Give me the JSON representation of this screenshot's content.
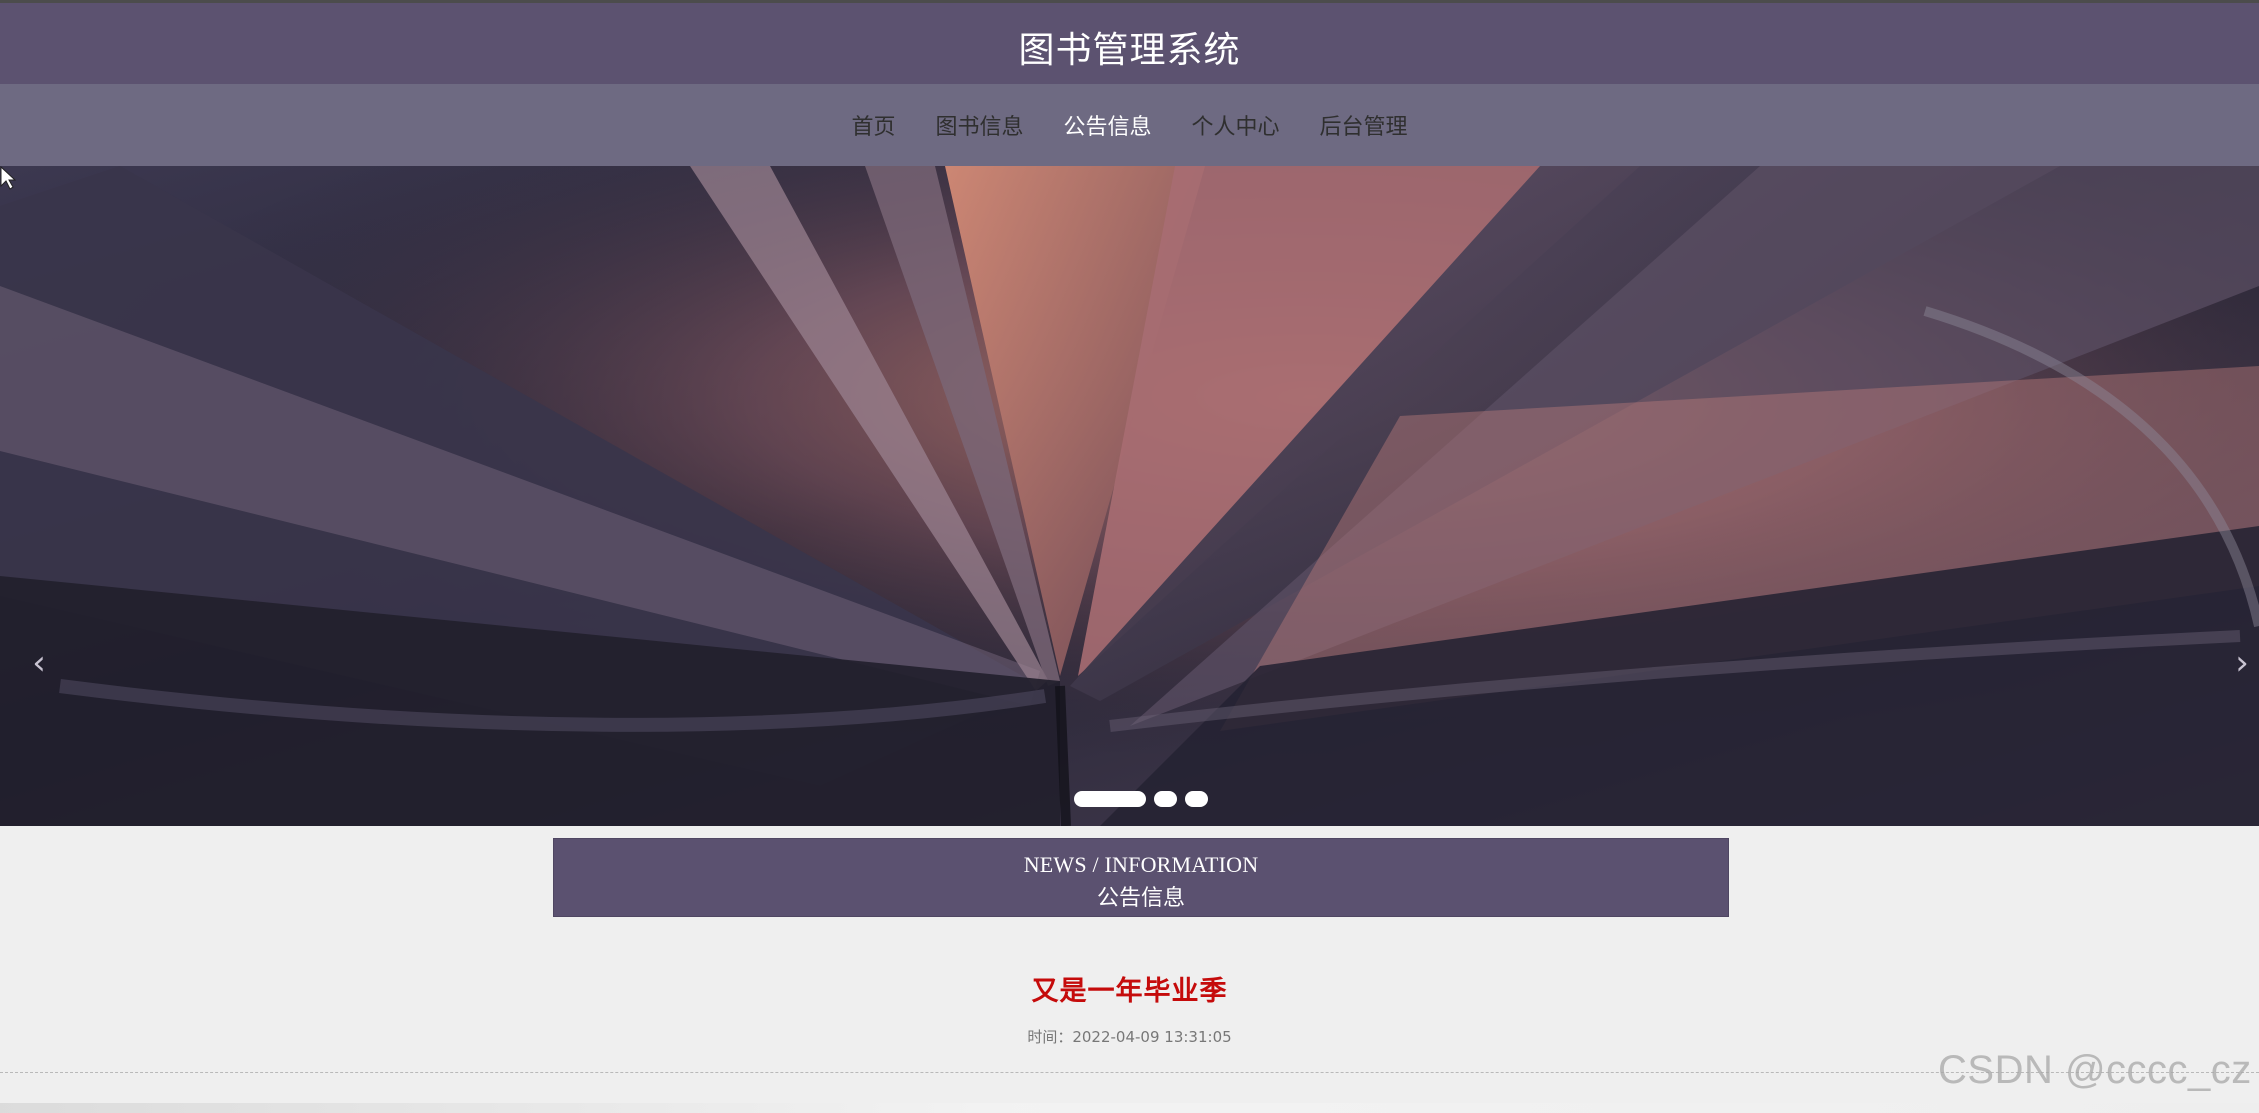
{
  "site": {
    "title": "图书管理系统"
  },
  "nav": {
    "items": [
      {
        "label": "首页"
      },
      {
        "label": "图书信息"
      },
      {
        "label": "公告信息"
      },
      {
        "label": "个人中心"
      },
      {
        "label": "后台管理"
      }
    ],
    "active_label": "公告信息"
  },
  "carousel": {
    "left_arrow": "‹",
    "right_arrow": "›",
    "slide_count": 3,
    "active_slide": 1
  },
  "section": {
    "title_en": "NEWS / INFORMATION",
    "title_cn": "公告信息"
  },
  "article": {
    "title": "又是一年毕业季",
    "meta": "时间：2022-04-09 13:31:05"
  },
  "watermark": "CSDN @cccc_cz",
  "colors": {
    "header": "#5c5270",
    "nav": "#6e6a82",
    "accent_red": "#c50b0b",
    "banner": "#5b5170"
  },
  "icons": {
    "left_arrow": "chevron-left-icon",
    "right_arrow": "chevron-right-icon",
    "cursor": "mouse-pointer-icon"
  }
}
